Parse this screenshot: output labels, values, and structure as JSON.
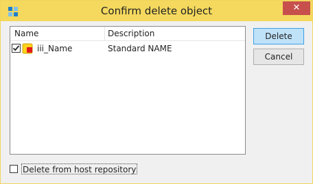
{
  "window": {
    "title": "Confirm delete object",
    "close_glyph": "✕",
    "app_icon": "app-icon",
    "titlebar_color": "#f4d95e",
    "close_color": "#c7504c"
  },
  "list": {
    "columns": [
      "Name",
      "Description"
    ],
    "rows": [
      {
        "checked": true,
        "icon": "object-name-icon",
        "name": "iii_Name",
        "description": "Standard NAME"
      }
    ]
  },
  "buttons": {
    "delete_label": "Delete",
    "cancel_label": "Cancel"
  },
  "options": {
    "delete_from_host_label": "Delete from host repository",
    "delete_from_host_checked": false
  }
}
